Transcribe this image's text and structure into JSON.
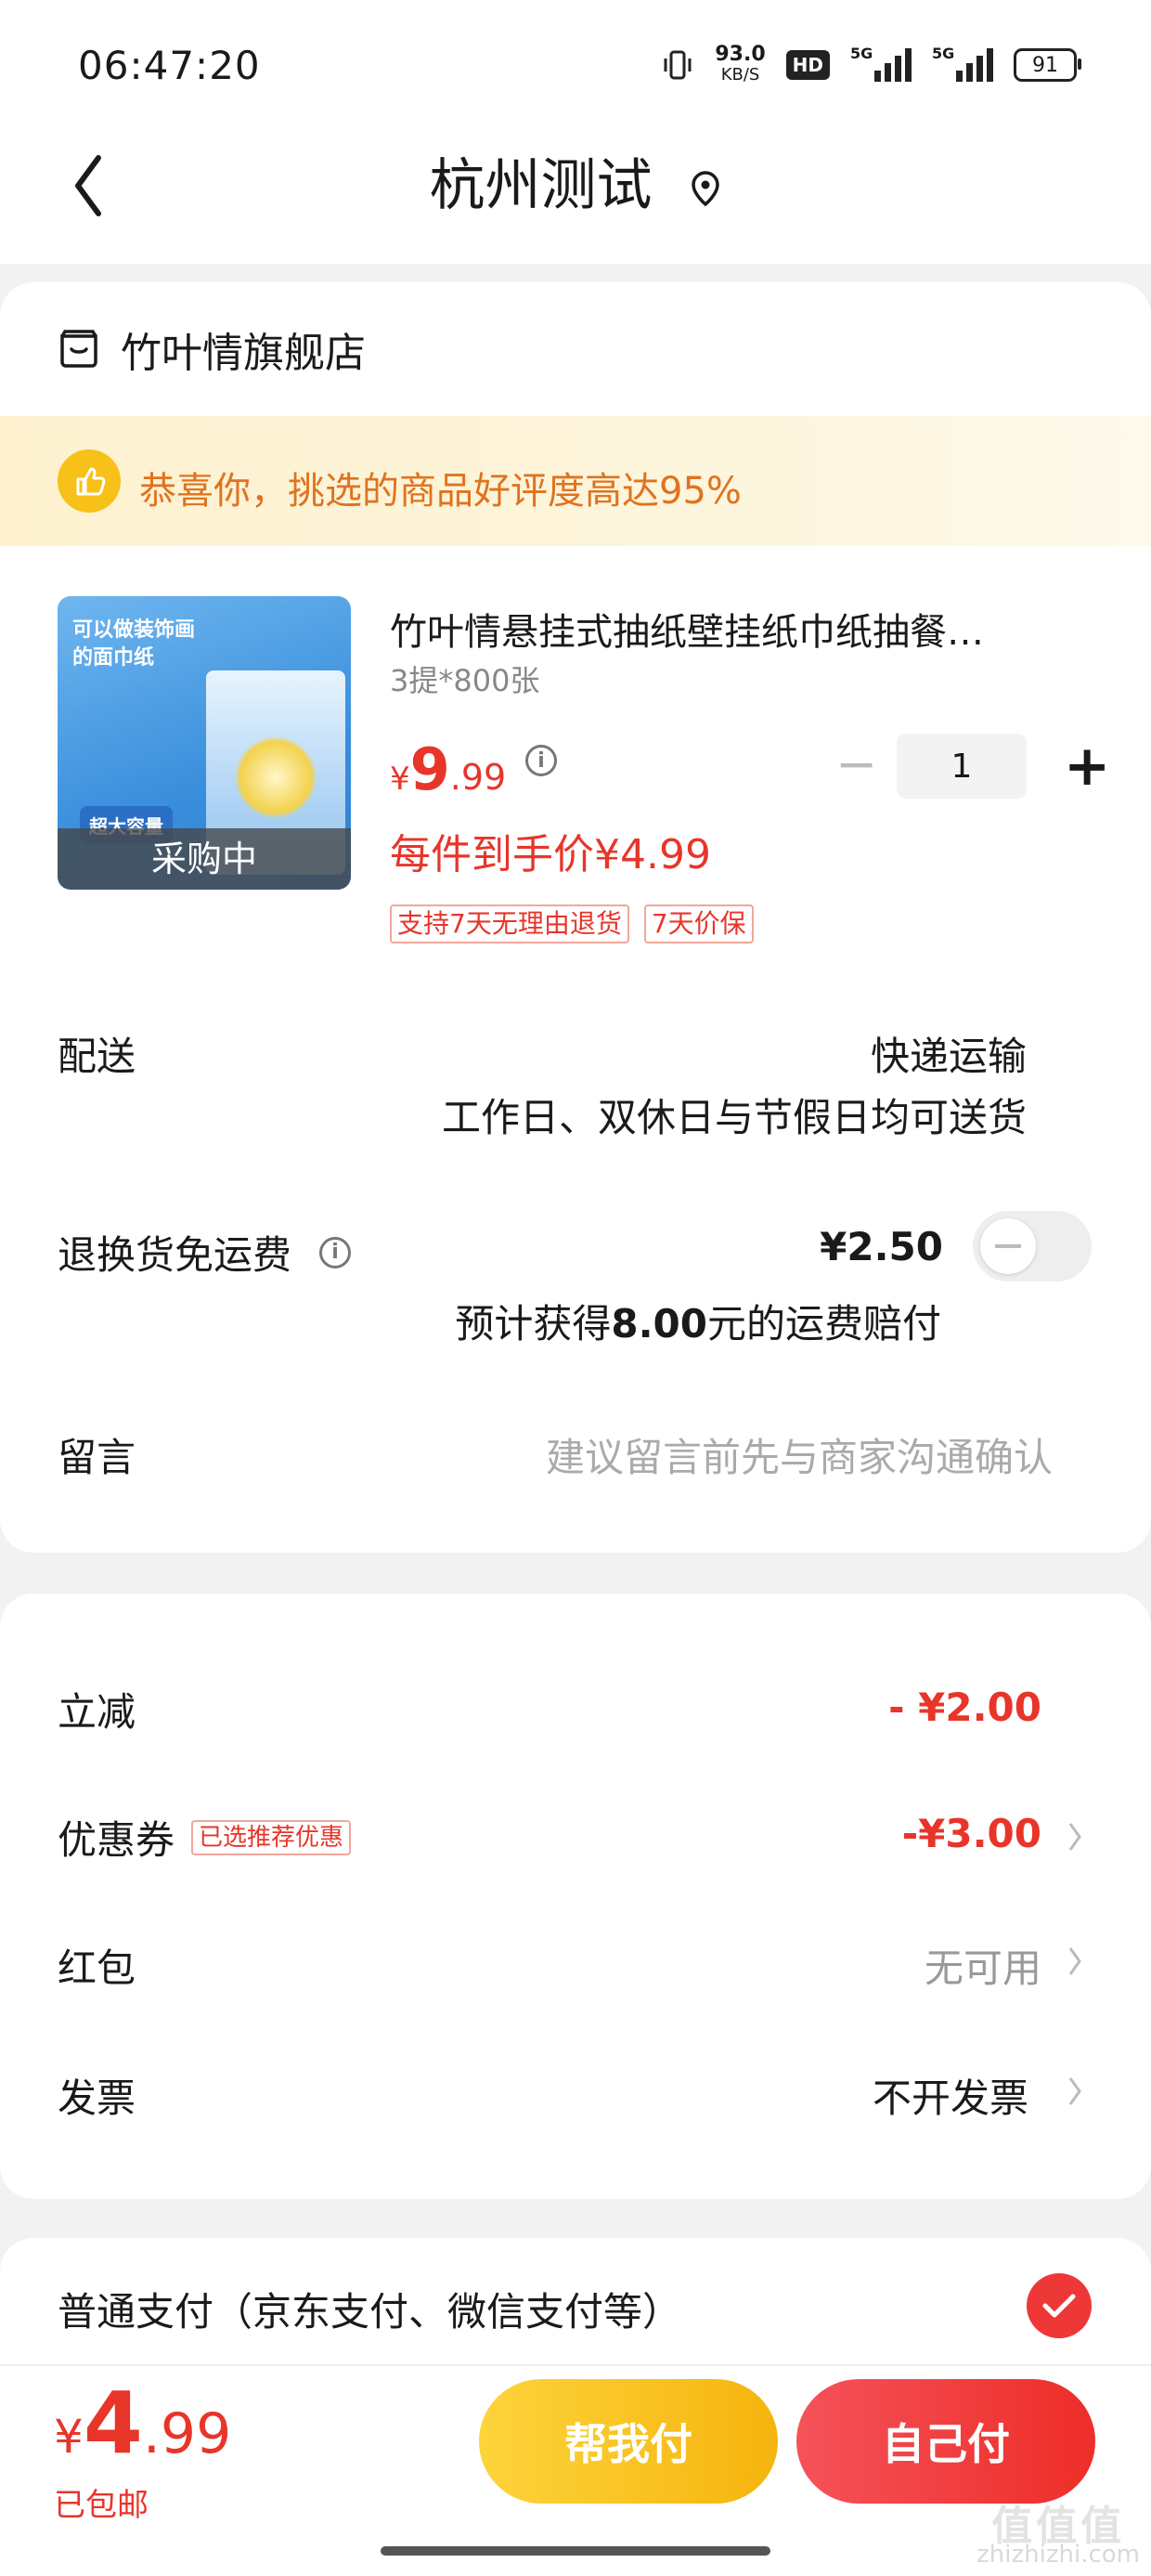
{
  "status_bar": {
    "time": "06:47:20",
    "net_speed": "93.0",
    "net_unit": "KB/S",
    "hd": "HD",
    "sig1": "5G",
    "sig2": "5G",
    "battery": "91"
  },
  "header": {
    "title": "杭州测试"
  },
  "store": {
    "name": "竹叶情旗舰店"
  },
  "banner": {
    "text": "恭喜你，挑选的商品好评度高达95%"
  },
  "product": {
    "image_text_top": "可以做装饰画\n的面巾纸",
    "image_text_badge": "超大容量",
    "image_overlay": "采购中",
    "name": "竹叶情悬挂式抽纸壁挂纸巾纸抽餐…",
    "spec": "3提*800张",
    "price_currency": "¥",
    "price_int": "9",
    "price_dec": ".99",
    "deal_price": "每件到手价¥4.99",
    "tags": [
      "支持7天无理由退货",
      "7天价保"
    ],
    "qty_minus": "−",
    "quantity": "1",
    "qty_plus": "+"
  },
  "delivery": {
    "label": "配送",
    "method": "快递运输",
    "note": "工作日、双休日与节假日均可送货"
  },
  "return_ship": {
    "label": "退换货免运费",
    "price": "¥2.50",
    "note_prefix": "预计获得",
    "note_amount": "8.00",
    "note_suffix": "元的运费赔付",
    "enabled": false
  },
  "message": {
    "label": "留言",
    "placeholder": "建议留言前先与商家沟通确认"
  },
  "discounts": {
    "instant": {
      "label": "立减",
      "value": "- ¥2.00"
    },
    "coupon": {
      "label": "优惠券",
      "tag": "已选推荐优惠",
      "value": "-¥3.00"
    },
    "redpacket": {
      "label": "红包",
      "value": "无可用"
    },
    "invoice": {
      "label": "发票",
      "value": "不开发票"
    }
  },
  "payment": {
    "label": "普通支付（京东支付、微信支付等）",
    "selected": true
  },
  "footer": {
    "currency": "¥",
    "total_int": "4",
    "total_dec": ".99",
    "shipping": "已包邮",
    "help_pay": "帮我付",
    "self_pay": "自己付"
  },
  "watermark": {
    "main": "值值值",
    "url": "zhizhizhi.com"
  },
  "colors": {
    "accent_red": "#e8352a",
    "help_yellow": "#f6b40e",
    "banner_orange": "#e0731f"
  }
}
